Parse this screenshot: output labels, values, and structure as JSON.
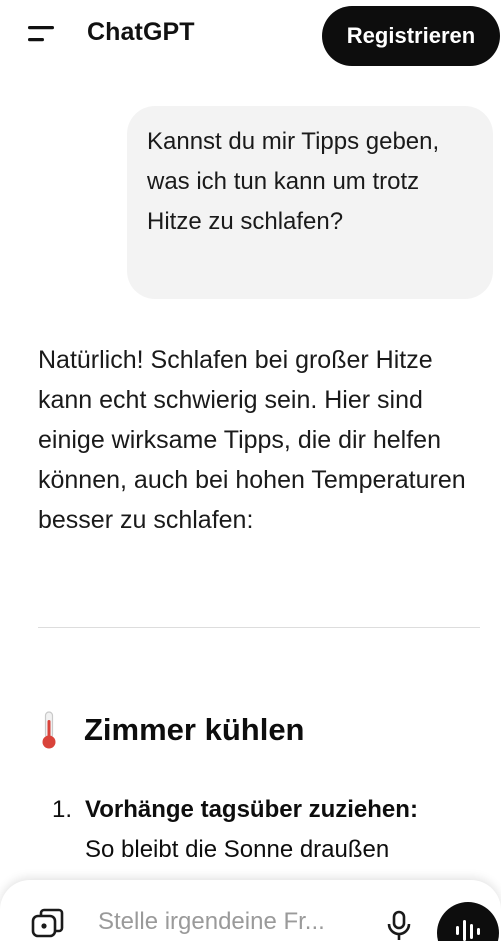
{
  "header": {
    "menu_icon": "menu-icon",
    "title": "ChatGPT",
    "register_label": "Registrieren"
  },
  "conversation": {
    "user_message": "Kannst du mir Tipps geben, was ich tun kann um trotz Hitze zu schlafen?",
    "assistant_intro": "Natürlich! Schlafen bei großer Hitze kann echt schwierig sein. Hier sind einige wirksame Tipps, die dir helfen können, auch bei hohen Temperaturen besser zu schlafen:",
    "section": {
      "icon": "thermometer-icon",
      "title": "Zimmer kühlen"
    },
    "list": [
      {
        "number": "1.",
        "bold": "Vorhänge tagsüber zuziehen:",
        "text": "So bleibt die Sonne draußen"
      }
    ]
  },
  "composer": {
    "attach_icon": "attach-icon",
    "placeholder": "Stelle irgendeine Fr...",
    "mic_icon": "microphone-icon",
    "voice_icon": "voice-mode-icon"
  },
  "colors": {
    "primary": "#0d0d0d",
    "bubble": "#f3f3f3",
    "thermometer": "#d9433a"
  }
}
